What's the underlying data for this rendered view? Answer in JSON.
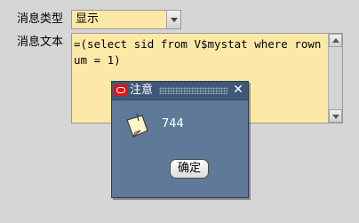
{
  "form": {
    "message_type_label": "消息类型",
    "message_text_label": "消息文本",
    "message_type_value": "显示",
    "message_text_value": "=(select sid from V$mystat where rownum = 1)"
  },
  "dialog": {
    "title": "注意",
    "message": "744",
    "ok_label": "确定"
  },
  "colors": {
    "field_bg": "#fde9a7",
    "dialog_bg": "#5f7a99",
    "titlebar_bg": "#3f5878",
    "page_bg": "#d6d6d6"
  },
  "icons": {
    "select_arrow": "chevron-down-icon",
    "scroll_up": "triangle-up-icon",
    "scroll_down": "triangle-down-icon",
    "app_icon": "oracle-icon",
    "close": "close-icon",
    "note": "note-icon"
  }
}
